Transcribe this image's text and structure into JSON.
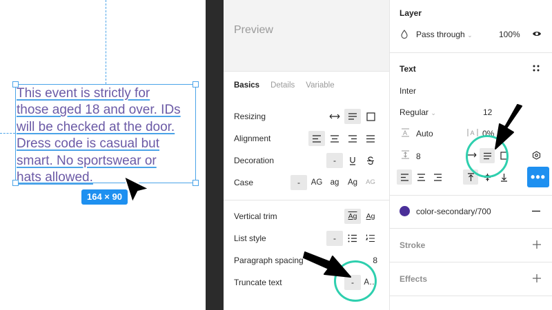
{
  "canvas": {
    "text_lines": [
      "This event is strictly for",
      "those aged 18 and over. IDs",
      "will be checked at the door.",
      "Dress code is casual but",
      "smart. No sportswear or",
      "hats allowed."
    ],
    "size_badge": "164 × 90",
    "colors": {
      "text": "#6b5aa6",
      "selection": "#4aa3e8",
      "badge": "#1e90f0"
    }
  },
  "middle": {
    "preview_label": "Preview",
    "tabs": [
      {
        "label": "Basics",
        "active": true
      },
      {
        "label": "Details",
        "active": false
      },
      {
        "label": "Variable",
        "active": false
      }
    ],
    "rows": {
      "resizing": "Resizing",
      "alignment": "Alignment",
      "decoration": "Decoration",
      "decoration_none": "-",
      "case": "Case",
      "case_none": "-",
      "case_options": [
        "AG",
        "ag",
        "Ag",
        "AG"
      ],
      "vertical_trim": "Vertical trim",
      "vertical_trim_options": [
        "Ag",
        "Ag"
      ],
      "list_style": "List style",
      "list_style_none": "-",
      "paragraph_spacing": "Paragraph spacing",
      "paragraph_spacing_value": "8",
      "truncate_text": "Truncate text",
      "truncate_none": "-",
      "truncate_option": "A…"
    }
  },
  "right": {
    "layer_title": "Layer",
    "blend_mode": "Pass through",
    "opacity": "100%",
    "text_title": "Text",
    "font_family": "Inter",
    "font_weight": "Regular",
    "font_size": "12",
    "line_height": "Auto",
    "letter_spacing": "0%",
    "paragraph_spacing": "8",
    "fill_name": "color-secondary/700",
    "fill_color": "#4a2f99",
    "stroke_title": "Stroke",
    "effects_title": "Effects",
    "more_button": "•••",
    "accent": "#1e90f0",
    "annotation_color": "#2ecfae"
  }
}
